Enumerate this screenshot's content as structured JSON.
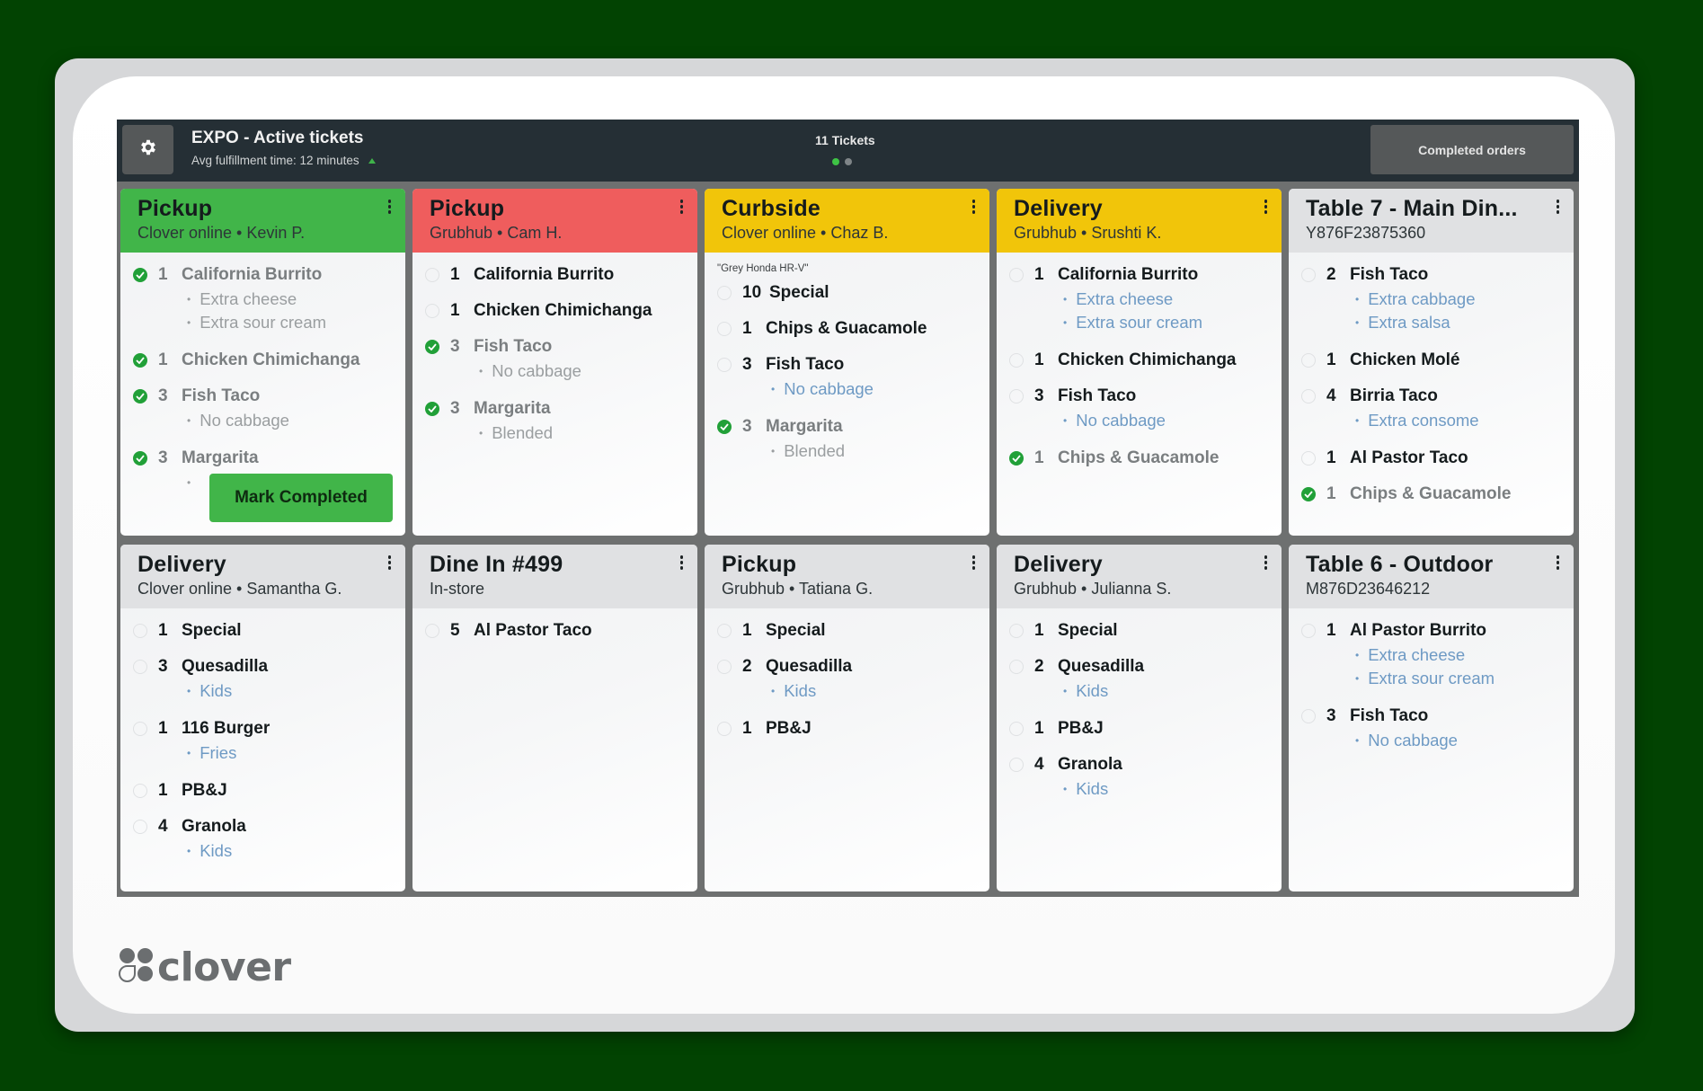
{
  "header": {
    "title": "EXPO - Active tickets",
    "subtitle": "Avg fulfillment time: 12 minutes",
    "trend_icon": "up-arrow-icon",
    "tickets_count": "11 Tickets",
    "pages": {
      "total": 2,
      "current": 1
    },
    "completed_orders_label": "Completed orders",
    "settings_icon": "gear-icon"
  },
  "colors": {
    "green": "#41b549",
    "red": "#ef5d5d",
    "yellow": "#f1c50a",
    "gray": "#e0e1e3",
    "modifier_blue": "#6e9ac4"
  },
  "tickets": [
    {
      "title": "Pickup",
      "subtitle": "Clover online •  Kevin P.",
      "header_color": "green",
      "action_label": "Mark Completed",
      "items": [
        {
          "qty": "1",
          "name": "California Burrito",
          "done": true,
          "mods": [
            "Extra cheese",
            "Extra sour cream"
          ]
        },
        {
          "qty": "1",
          "name": "Chicken Chimichanga",
          "done": true,
          "mods": []
        },
        {
          "qty": "3",
          "name": "Fish Taco",
          "done": true,
          "mods": [
            "No cabbage"
          ]
        },
        {
          "qty": "3",
          "name": "Margarita",
          "done": true,
          "mods": [
            ""
          ]
        }
      ]
    },
    {
      "title": "Pickup",
      "subtitle": "Grubhub •  Cam H.",
      "header_color": "red",
      "items": [
        {
          "qty": "1",
          "name": "California Burrito",
          "done": false,
          "mods": []
        },
        {
          "qty": "1",
          "name": "Chicken Chimichanga",
          "done": false,
          "mods": []
        },
        {
          "qty": "3",
          "name": "Fish Taco",
          "done": true,
          "mods": [
            "No cabbage"
          ]
        },
        {
          "qty": "3",
          "name": "Margarita",
          "done": true,
          "mods": [
            "Blended"
          ]
        }
      ]
    },
    {
      "title": "Curbside",
      "subtitle": "Clover online •  Chaz B.",
      "header_color": "yellow",
      "note": "\"Grey Honda HR-V\"",
      "items": [
        {
          "qty": "10",
          "name": "Special",
          "done": false,
          "mods": []
        },
        {
          "qty": "1",
          "name": "Chips & Guacamole",
          "done": false,
          "mods": []
        },
        {
          "qty": "3",
          "name": "Fish Taco",
          "done": false,
          "mods": [
            "No cabbage"
          ]
        },
        {
          "qty": "3",
          "name": "Margarita",
          "done": true,
          "mods": [
            "Blended"
          ]
        }
      ]
    },
    {
      "title": "Delivery",
      "subtitle": "Grubhub •  Srushti K.",
      "header_color": "yellow",
      "items": [
        {
          "qty": "1",
          "name": "California Burrito",
          "done": false,
          "mods": [
            "Extra cheese",
            "Extra sour cream"
          ]
        },
        {
          "qty": "1",
          "name": "Chicken Chimichanga",
          "done": false,
          "mods": []
        },
        {
          "qty": "3",
          "name": "Fish Taco",
          "done": false,
          "mods": [
            "No cabbage"
          ]
        },
        {
          "qty": "1",
          "name": "Chips & Guacamole",
          "done": true,
          "mods": []
        }
      ]
    },
    {
      "title": "Table 7 - Main Din...",
      "subtitle": "Y876F23875360",
      "header_color": "gray",
      "items": [
        {
          "qty": "2",
          "name": "Fish Taco",
          "done": false,
          "mods": [
            "Extra cabbage",
            "Extra salsa"
          ]
        },
        {
          "qty": "1",
          "name": "Chicken Molé",
          "done": false,
          "mods": []
        },
        {
          "qty": "4",
          "name": "Birria Taco",
          "done": false,
          "mods": [
            "Extra consome"
          ]
        },
        {
          "qty": "1",
          "name": "Al Pastor Taco",
          "done": false,
          "mods": []
        },
        {
          "qty": "1",
          "name": "Chips & Guacamole",
          "done": true,
          "mods": []
        }
      ]
    },
    {
      "title": "Delivery",
      "subtitle": "Clover online •  Samantha G.",
      "header_color": "gray",
      "items": [
        {
          "qty": "1",
          "name": "Special",
          "done": false,
          "mods": []
        },
        {
          "qty": "3",
          "name": "Quesadilla",
          "done": false,
          "mods": [
            "Kids"
          ]
        },
        {
          "qty": "1",
          "name": "116 Burger",
          "done": false,
          "mods": [
            "Fries"
          ]
        },
        {
          "qty": "1",
          "name": "PB&J",
          "done": false,
          "mods": []
        },
        {
          "qty": "4",
          "name": "Granola",
          "done": false,
          "mods": [
            "Kids"
          ]
        }
      ]
    },
    {
      "title": "Dine In #499",
      "subtitle": "In-store",
      "header_color": "gray",
      "items": [
        {
          "qty": "5",
          "name": "Al Pastor Taco",
          "done": false,
          "mods": []
        }
      ]
    },
    {
      "title": "Pickup",
      "subtitle": "Grubhub •  Tatiana G.",
      "header_color": "gray",
      "items": [
        {
          "qty": "1",
          "name": "Special",
          "done": false,
          "mods": []
        },
        {
          "qty": "2",
          "name": "Quesadilla",
          "done": false,
          "mods": [
            "Kids"
          ]
        },
        {
          "qty": "1",
          "name": "PB&J",
          "done": false,
          "mods": []
        }
      ]
    },
    {
      "title": "Delivery",
      "subtitle": "Grubhub •  Julianna S.",
      "header_color": "gray",
      "items": [
        {
          "qty": "1",
          "name": "Special",
          "done": false,
          "mods": []
        },
        {
          "qty": "2",
          "name": "Quesadilla",
          "done": false,
          "mods": [
            "Kids"
          ]
        },
        {
          "qty": "1",
          "name": "PB&J",
          "done": false,
          "mods": []
        },
        {
          "qty": "4",
          "name": "Granola",
          "done": false,
          "mods": [
            "Kids"
          ]
        }
      ]
    },
    {
      "title": "Table 6 - Outdoor",
      "subtitle": "M876D23646212",
      "header_color": "gray",
      "items": [
        {
          "qty": "1",
          "name": "Al Pastor Burrito",
          "done": false,
          "mods": [
            "Extra cheese",
            "Extra sour cream"
          ]
        },
        {
          "qty": "3",
          "name": "Fish Taco",
          "done": false,
          "mods": [
            "No cabbage"
          ]
        }
      ]
    }
  ],
  "brand": {
    "logo_text": "clover",
    "logo_icon": "clover-logo-icon"
  }
}
